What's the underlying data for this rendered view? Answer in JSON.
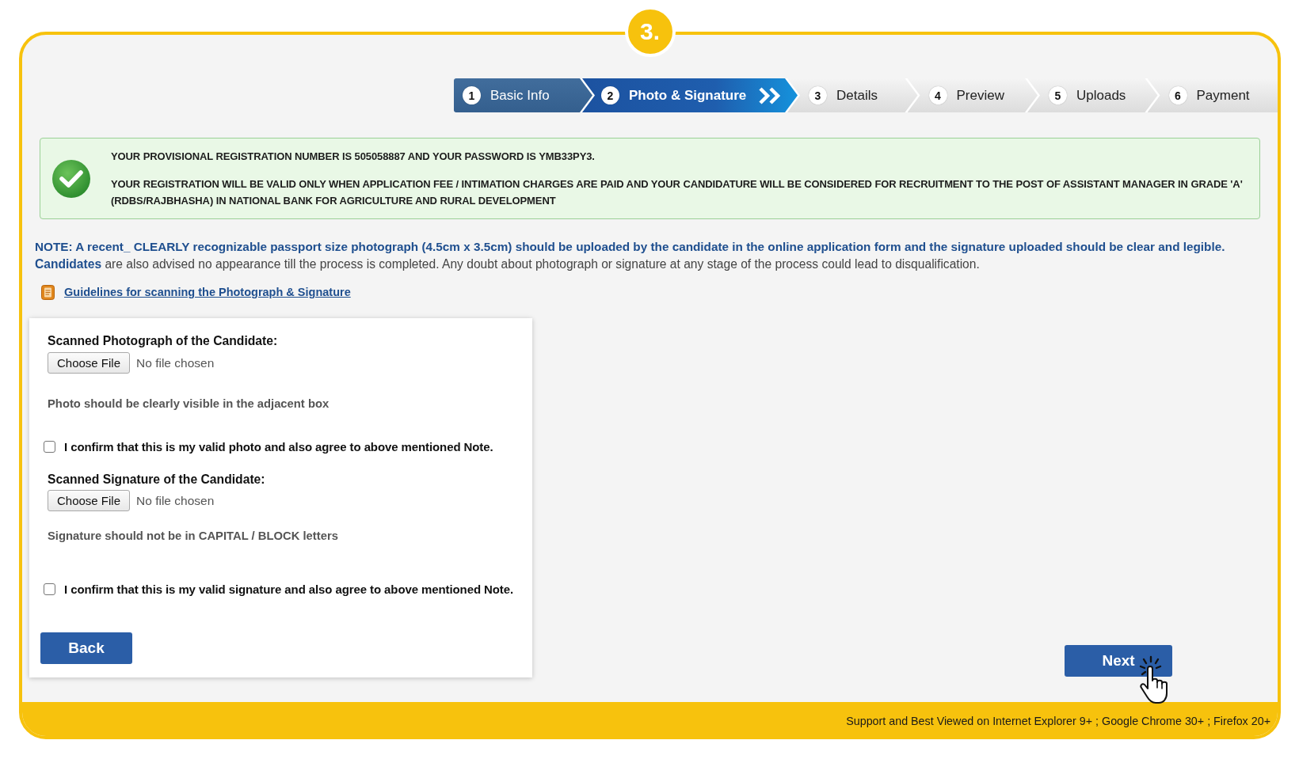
{
  "badge": "3.",
  "steps": [
    {
      "number": "1",
      "label": "Basic Info",
      "completed": true,
      "selected": false
    },
    {
      "number": "2",
      "label": "Photo & Signature",
      "completed": false,
      "selected": true
    },
    {
      "number": "3",
      "label": "Details",
      "completed": false,
      "selected": false
    },
    {
      "number": "4",
      "label": "Preview",
      "completed": false,
      "selected": false
    },
    {
      "number": "5",
      "label": "Uploads",
      "completed": false,
      "selected": false
    },
    {
      "number": "6",
      "label": "Payment",
      "completed": false,
      "selected": false
    }
  ],
  "notice": {
    "lines": [
      "YOUR PROVISIONAL REGISTRATION NUMBER IS 505058887 AND YOUR PASSWORD IS YMB33PY3.",
      "YOUR REGISTRATION WILL BE VALID ONLY WHEN APPLICATION FEE / INTIMATION CHARGES ARE PAID AND YOUR CANDIDATURE WILL BE CONSIDERED FOR RECRUITMENT TO THE POST OF ASSISTANT MANAGER IN GRADE 'A' (RDBS/RAJBHASHA) IN NATIONAL BANK FOR AGRICULTURE AND RURAL DEVELOPMENT"
    ]
  },
  "note": {
    "text": "NOTE: A recent_ CLEARLY recognizable passport size photograph (4.5cm x 3.5cm) should be uploaded by the candidate in the online application form and the signature uploaded should be clear and legible.",
    "detail": "**Candidates** are also advised no appearance till the process is completed. Any doubt about photograph or signature at any stage of the process could lead to disqualification."
  },
  "guidelines_link": "Guidelines for scanning the Photograph & Signature",
  "uploads": [
    {
      "title": "Scanned Photograph of the Candidate:",
      "button": "Choose File",
      "status": "No file chosen",
      "hint": "Photo should be clearly visible in the adjacent box",
      "confirm": {
        "label": "I confirm that this is my valid photo and also agree to above mentioned Note.",
        "checked": false
      }
    },
    {
      "title": "Scanned Signature of the Candidate:",
      "button": "Choose File",
      "status": "No file chosen",
      "hint": "Signature should not be in CAPITAL / BLOCK letters",
      "confirm": {
        "label": "I confirm that this is my valid signature and also agree to above mentioned Note.",
        "checked": false
      }
    }
  ],
  "buttons": {
    "back": "Back",
    "next": "Next"
  },
  "footer": "Support and Best Viewed on Internet Explorer 9+ ; Google Chrome 30+ ; Firefox 20+"
}
